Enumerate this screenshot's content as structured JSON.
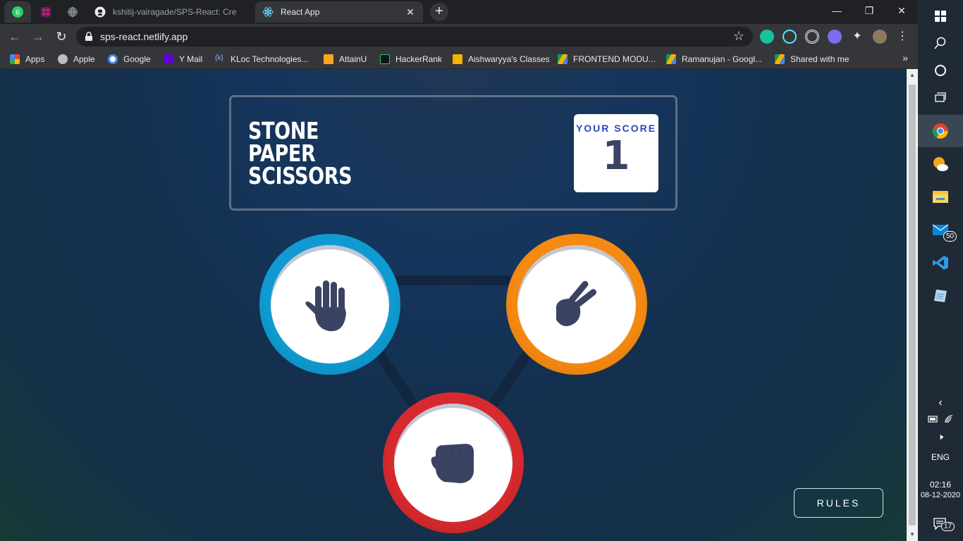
{
  "browser": {
    "tabs": [
      {
        "title": "kshitij-vairagade/SPS-React: Cre",
        "active": false
      },
      {
        "title": "React App",
        "active": true
      }
    ],
    "mini_tabs": [
      {
        "badge": "6"
      }
    ],
    "url": "sps-react.netlify.app",
    "bookmarks": [
      {
        "label": "Apps"
      },
      {
        "label": "Apple"
      },
      {
        "label": "Google"
      },
      {
        "label": "Y Mail"
      },
      {
        "label": "KLoc Technologies..."
      },
      {
        "label": "AttainU"
      },
      {
        "label": "HackerRank"
      },
      {
        "label": "Aishwaryya's Classes"
      },
      {
        "label": "FRONTEND MODU..."
      },
      {
        "label": "Ramanujan - Googl..."
      },
      {
        "label": "Shared with me"
      }
    ],
    "bookmarks_more": "»"
  },
  "game": {
    "title_lines": [
      "STONE",
      "PAPER",
      "SCISSORS"
    ],
    "score_label": "YOUR SCORE",
    "score_value": "1",
    "rules_label": "RULES",
    "colors": {
      "paper": "#0f9bd1",
      "scissors": "#f48a12",
      "stone": "#d72a2e",
      "hand": "#3b4363"
    }
  },
  "taskbar": {
    "language": "ENG",
    "time": "02:16",
    "date": "08-12-2020",
    "mail_badge": "50",
    "notifications_badge": "17"
  }
}
